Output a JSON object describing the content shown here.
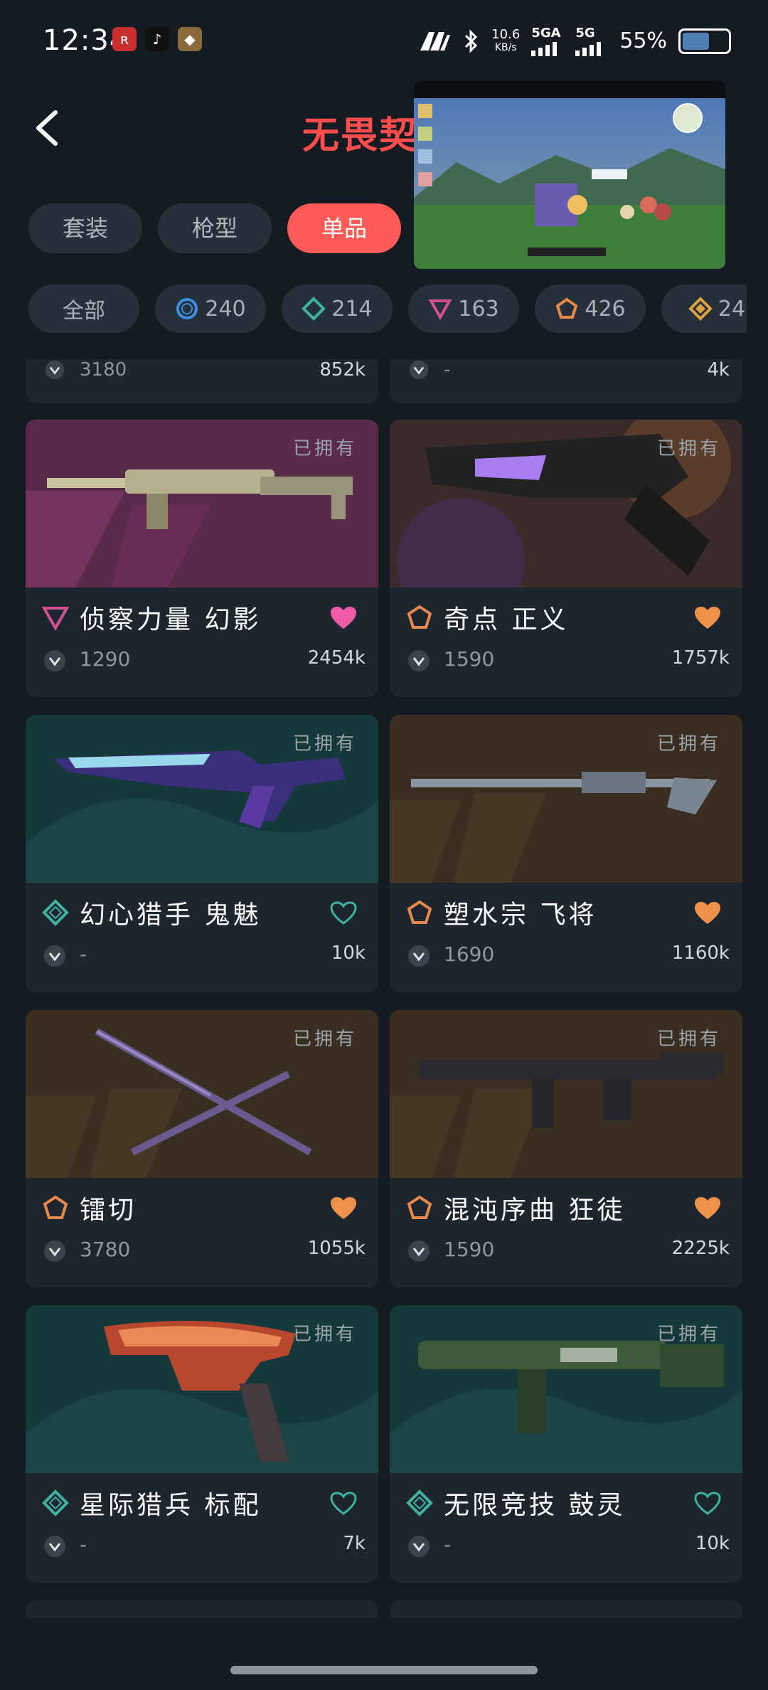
{
  "status": {
    "time": "12:34",
    "apps": [
      {
        "name": "app-icon",
        "glyph": "ʀ",
        "color": "#c92f2f"
      },
      {
        "name": "tiktok-icon",
        "glyph": "♪",
        "color": "#111111"
      },
      {
        "name": "game-app-icon",
        "glyph": "◆",
        "color": "#8a6a3a"
      }
    ],
    "speed_value": "10.6",
    "speed_unit": "KB/s",
    "sim1_label": "5GA",
    "sim2_label": "5G",
    "battery": "55%",
    "battery_level": 0.55
  },
  "header": {
    "logo_text": "无畏契约"
  },
  "tabs": [
    {
      "label": "套装",
      "active": false
    },
    {
      "label": "枪型",
      "active": false
    },
    {
      "label": "单品",
      "active": true
    }
  ],
  "filters": [
    {
      "label": "全部",
      "icon": "none",
      "color": ""
    },
    {
      "label": "240",
      "icon": "circle-tier-icon",
      "color": "#3e8ee0"
    },
    {
      "label": "214",
      "icon": "diamond-tier-icon",
      "color": "#3fb39d"
    },
    {
      "label": "163",
      "icon": "triangle-tier-icon",
      "color": "#d44f8d"
    },
    {
      "label": "426",
      "icon": "pentagon-tier-icon",
      "color": "#e7894a"
    },
    {
      "label": "24",
      "icon": "diamond-gold-tier-icon",
      "color": "#d9a441"
    }
  ],
  "partial_top": {
    "left_price": "3180",
    "left_count": "852k",
    "right_price": "-",
    "right_count": "4k"
  },
  "cards": [
    {
      "owned": "已拥有",
      "tier": "triangle",
      "tier_color": "#d44f8d",
      "name": "侦察力量 幻影",
      "price": "1290",
      "count": "2454k",
      "liked": true,
      "heart_color": "#f05aa6",
      "bg": "purple"
    },
    {
      "owned": "已拥有",
      "tier": "pentagon",
      "tier_color": "#e7894a",
      "name": "奇点 正义",
      "price": "1590",
      "count": "1757k",
      "liked": true,
      "heart_color": "#f0914a",
      "bg": "dark"
    },
    {
      "owned": "已拥有",
      "tier": "diamond",
      "tier_color": "#3fb39d",
      "name": "幻心猎手 鬼魅",
      "price": "-",
      "count": "10k",
      "liked": false,
      "heart_color": "#3fb39d",
      "bg": "teal"
    },
    {
      "owned": "已拥有",
      "tier": "pentagon",
      "tier_color": "#e7894a",
      "name": "塑水宗 飞将",
      "price": "1690",
      "count": "1160k",
      "liked": true,
      "heart_color": "#f0914a",
      "bg": "brown"
    },
    {
      "owned": "已拥有",
      "tier": "pentagon",
      "tier_color": "#e7894a",
      "name": "镭切",
      "price": "3780",
      "count": "1055k",
      "liked": true,
      "heart_color": "#f0914a",
      "bg": "brown"
    },
    {
      "owned": "已拥有",
      "tier": "pentagon",
      "tier_color": "#e7894a",
      "name": "混沌序曲 狂徒",
      "price": "1590",
      "count": "2225k",
      "liked": true,
      "heart_color": "#f0914a",
      "bg": "brown"
    },
    {
      "owned": "已拥有",
      "tier": "diamond",
      "tier_color": "#3fb39d",
      "name": "星际猎兵 标配",
      "price": "-",
      "count": "7k",
      "liked": false,
      "heart_color": "#3fb39d",
      "bg": "teal"
    },
    {
      "owned": "已拥有",
      "tier": "diamond",
      "tier_color": "#3fb39d",
      "name": "无限竞技 鼓灵",
      "price": "-",
      "count": "10k",
      "liked": false,
      "heart_color": "#3fb39d",
      "bg": "teal"
    }
  ]
}
